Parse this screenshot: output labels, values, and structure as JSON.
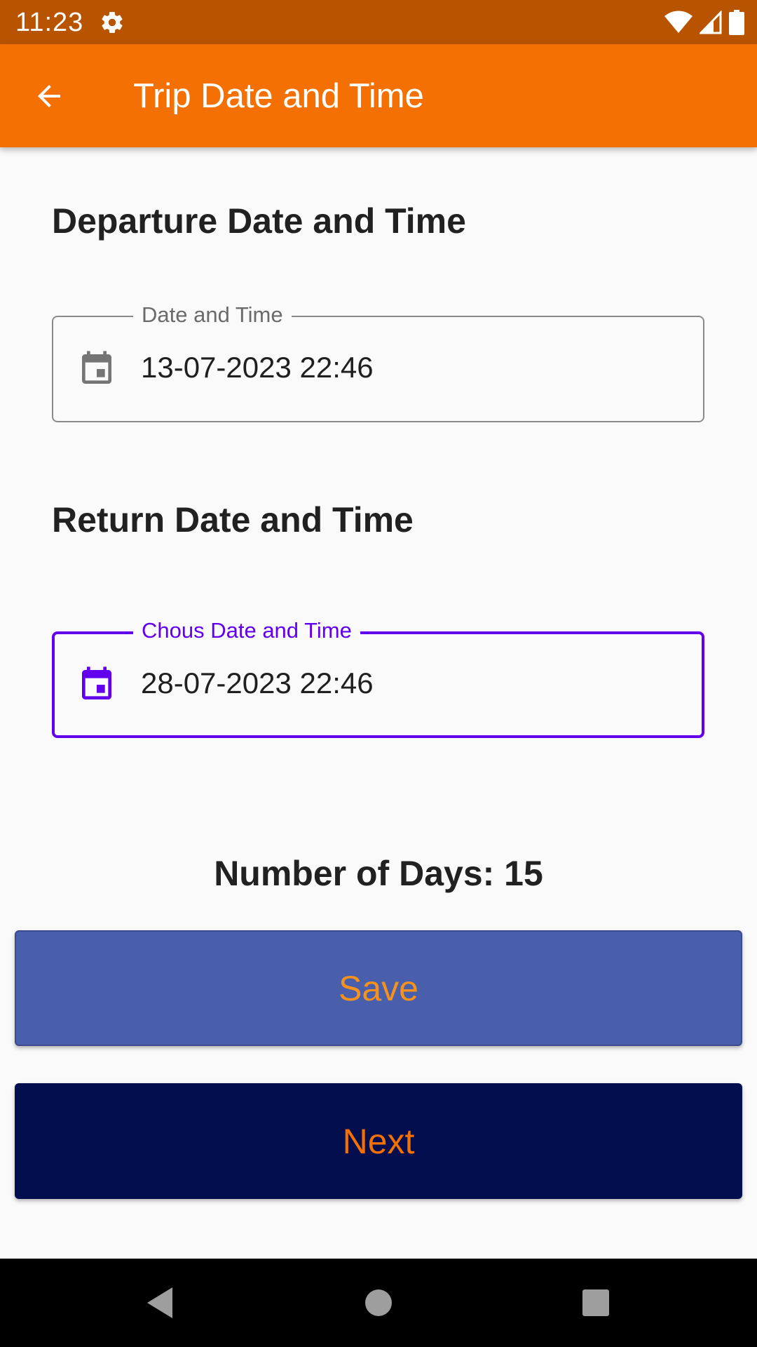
{
  "status_bar": {
    "time": "11:23",
    "icons": [
      "settings-icon",
      "wifi-icon",
      "signal-icon",
      "battery-icon"
    ]
  },
  "app_bar": {
    "title": "Trip Date and Time",
    "back_icon": "arrow-back-icon",
    "background_color": "#f57003"
  },
  "departure": {
    "heading": "Departure Date and Time",
    "field_label": "Date and Time",
    "value": "13-07-2023 22:46",
    "icon": "calendar-icon"
  },
  "return": {
    "heading": "Return Date and Time",
    "field_label": "Chous Date and Time",
    "value": "28-07-2023 22:46",
    "icon": "calendar-icon",
    "accent_color": "#6200ee"
  },
  "summary": {
    "days_text": "Number of Days: 15"
  },
  "actions": {
    "save_label": "Save",
    "next_label": "Next",
    "save_bg": "#4a5fab",
    "next_bg": "#020e4d"
  },
  "nav_bar": {
    "icons": [
      "back-triangle-icon",
      "home-circle-icon",
      "recents-square-icon"
    ]
  }
}
